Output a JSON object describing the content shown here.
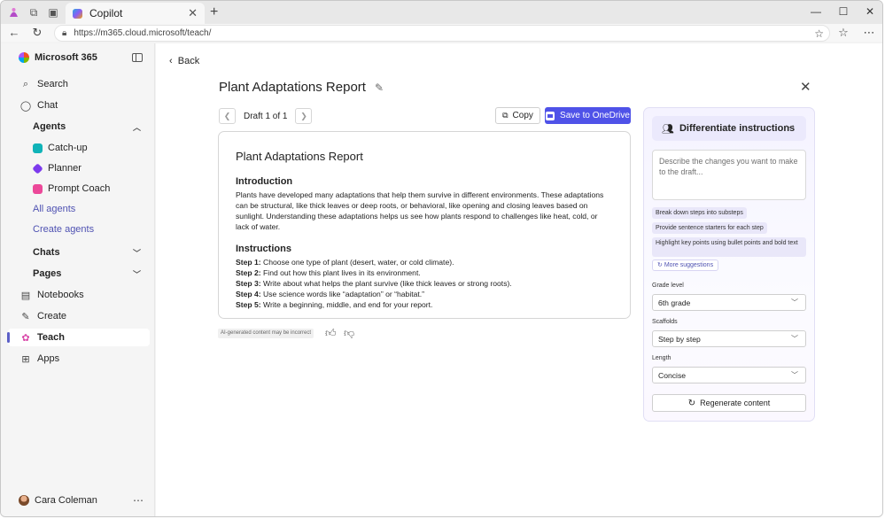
{
  "browser": {
    "tab_title": "Copilot",
    "url": "https://m365.cloud.microsoft/teach/"
  },
  "sidebar": {
    "brand": "Microsoft 365",
    "search": "Search",
    "chat": "Chat",
    "agents_heading": "Agents",
    "agents": [
      {
        "label": "Catch-up",
        "color": "#10b3b8"
      },
      {
        "label": "Planner",
        "color": "#7c3aed"
      },
      {
        "label": "Prompt Coach",
        "color": "#ec4899"
      }
    ],
    "all_agents": "All agents",
    "create_agents": "Create agents",
    "chats": "Chats",
    "pages": "Pages",
    "notebooks": "Notebooks",
    "create": "Create",
    "teach": "Teach",
    "apps": "Apps",
    "user_name": "Cara Coleman"
  },
  "main": {
    "back": "Back",
    "title": "Plant Adaptations Report",
    "draft_label": "Draft 1 of 1",
    "copy_label": "Copy",
    "save_label": "Save to OneDrive",
    "ai_note": "AI-generated content may be incorrect",
    "document": {
      "title": "Plant Adaptations Report",
      "intro_heading": "Introduction",
      "intro_text": "Plants have developed many adaptations that help them survive in different environments. These adaptations can be structural, like thick leaves or deep roots, or behavioral, like opening and closing leaves based on sunlight. Understanding these adaptations helps us see how plants respond to challenges like heat, cold, or lack of water.",
      "instructions_heading": "Instructions",
      "steps": [
        {
          "label": "Step 1:",
          "text": " Choose one type of plant (desert, water, or cold climate)."
        },
        {
          "label": "Step 2:",
          "text": " Find out how this plant lives in its environment."
        },
        {
          "label": "Step 3:",
          "text": " Write about what helps the plant survive (like thick leaves or strong roots)."
        },
        {
          "label": "Step 4:",
          "text": " Use science words like “adaptation” or “habitat.”"
        },
        {
          "label": "Step 5:",
          "text": " Write a beginning, middle, and end for your report."
        }
      ]
    }
  },
  "panel": {
    "heading": "Differentiate instructions",
    "input_placeholder": "Describe the changes you want to make to the draft...",
    "suggestions": [
      "Break down steps into substeps",
      "Provide sentence starters for each step",
      "Highlight key points using bullet points and bold text"
    ],
    "more_suggestions": "More suggestions",
    "grade_label": "Grade level",
    "grade_value": "6th grade",
    "scaffolds_label": "Scaffolds",
    "scaffolds_value": "Step by step",
    "length_label": "Length",
    "length_value": "Concise",
    "regenerate": "Regenerate content"
  },
  "colors": {
    "accent": "#4f52e8",
    "link": "#4f52b2"
  }
}
